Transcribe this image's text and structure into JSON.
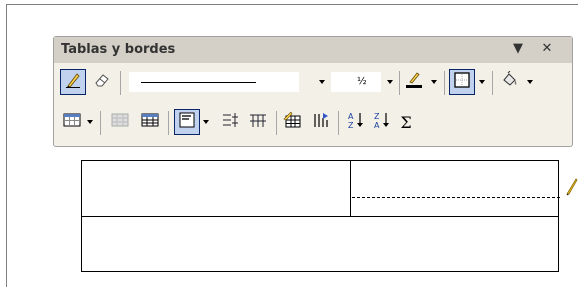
{
  "toolbar": {
    "title": "Tablas y bordes",
    "menu_arrow": "▼",
    "close": "✕",
    "line_weight": "½"
  },
  "icons": {
    "draw_table": "pencil-icon",
    "eraser": "eraser-icon",
    "line_style": "line-style-icon",
    "line_weight": "line-weight-icon",
    "border_color": "border-color-icon",
    "outside_border": "outside-border-icon",
    "shading_color": "shading-color-icon",
    "insert_table": "insert-table-icon",
    "merge_cells": "merge-cells-icon",
    "split_cells": "split-cells-icon",
    "align_top_left": "align-top-left-icon",
    "distribute_rows": "distribute-rows-icon",
    "distribute_columns": "distribute-columns-icon",
    "autoformat": "table-autoformat-icon",
    "change_text_direction": "text-direction-icon",
    "sort_ascending": "sort-ascending-icon",
    "sort_descending": "sort-descending-icon",
    "autosum": "autosum-icon"
  },
  "colors": {
    "toolbar_bg": "#f3f1e7",
    "selected_bg": "#c1d2ee",
    "selected_border": "#0a246a",
    "border_color_swatch": "#000000"
  }
}
